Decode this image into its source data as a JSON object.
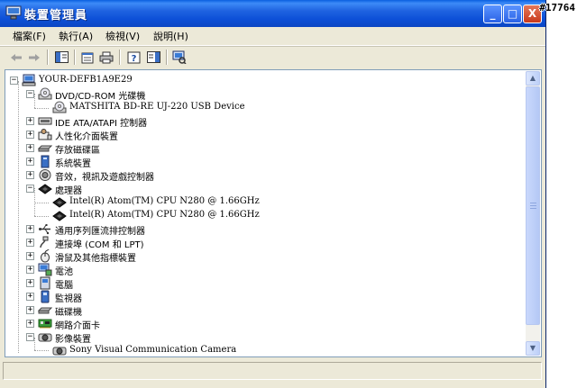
{
  "window": {
    "title": "裝置管理員",
    "buttons": {
      "minimize": "_",
      "maximize": "□",
      "close": "X"
    }
  },
  "watermark": "#17764",
  "menu": [
    {
      "label": "檔案(F)"
    },
    {
      "label": "執行(A)"
    },
    {
      "label": "檢視(V)"
    },
    {
      "label": "說明(H)"
    }
  ],
  "toolbar": {
    "icons": [
      "back-icon",
      "forward-icon",
      "show-hide-console-tree-icon",
      "properties-icon",
      "print-icon",
      "help-icon",
      "show-hide-action-pane-icon",
      "scan-hardware-icon"
    ]
  },
  "tree": {
    "root": "YOUR-DEFB1A9E29",
    "dvd": {
      "label": "DVD/CD-ROM 光碟機",
      "child": "MATSHITA BD-RE UJ-220 USB Device"
    },
    "ide": "IDE ATA/ATAPI 控制器",
    "hid": "人性化介面裝置",
    "storage": "存放磁碟區",
    "system": "系統裝置",
    "sound": "音效，視訊及遊戲控制器",
    "cpu": {
      "label": "處理器",
      "child1": "Intel(R) Atom(TM) CPU N280   @ 1.66GHz",
      "child2": "Intel(R) Atom(TM) CPU N280   @ 1.66GHz"
    },
    "usb": "通用序列匯流排控制器",
    "ports": "連接埠 (COM 和 LPT)",
    "mouse": "滑鼠及其他指標裝置",
    "battery": "電池",
    "computer": "電腦",
    "monitor": "監視器",
    "disk": "磁碟機",
    "network": "網路介面卡",
    "imaging": {
      "label": "影像裝置",
      "child": "Sony Visual Communication Camera"
    }
  },
  "status": ""
}
